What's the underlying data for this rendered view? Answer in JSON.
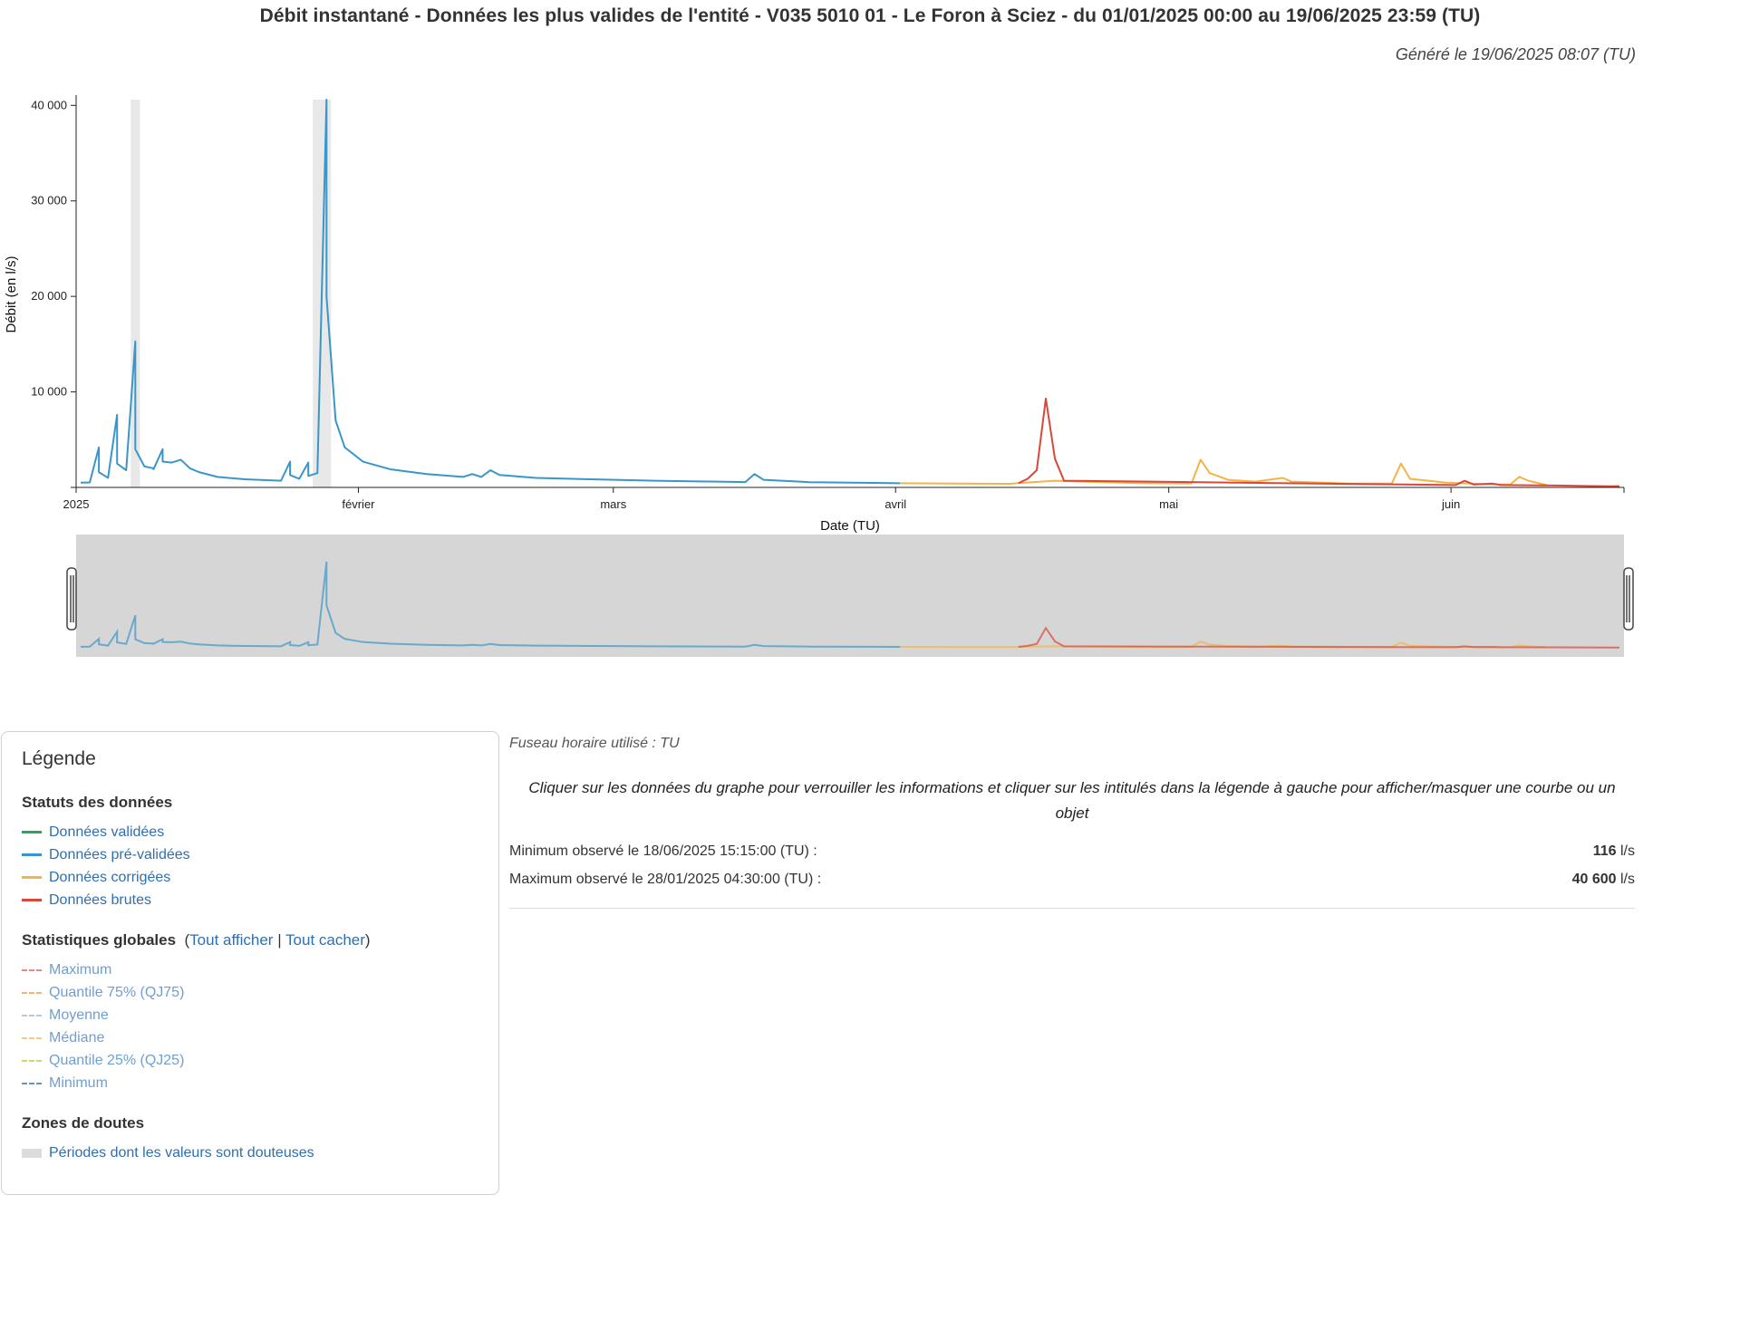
{
  "header": {
    "title": "Débit instantané - Données les plus valides de l'entité - V035 5010 01 - Le Foron à Sciez - du 01/01/2025 00:00 au 19/06/2025 23:59 (TU)",
    "generated": "Généré le 19/06/2025 08:07 (TU)"
  },
  "chart_data": {
    "type": "line",
    "title": "",
    "xlabel": "Date (TU)",
    "ylabel": "Débit (en l/s)",
    "ylim": [
      0,
      40600
    ],
    "yticks": [
      0,
      10000,
      20000,
      30000,
      40000
    ],
    "ytick_labels": [
      "",
      "10 000",
      "20 000",
      "30 000",
      "40 000"
    ],
    "xlim": [
      "2025-01-01",
      "2025-06-19"
    ],
    "xticks": [
      "2025-01-01",
      "2025-02-01",
      "2025-03-01",
      "2025-04-01",
      "2025-05-01",
      "2025-06-01"
    ],
    "xtick_labels": [
      "2025",
      "février",
      "mars",
      "avril",
      "mai",
      "juin"
    ],
    "doubt_zones": [
      [
        "2025-01-07",
        "2025-01-07"
      ],
      [
        "2025-01-27",
        "2025-01-28"
      ]
    ],
    "series": [
      {
        "name": "Données pré-validées",
        "color": "#3a96c8",
        "points": [
          [
            "2025-01-01",
            500
          ],
          [
            "2025-01-02",
            520
          ],
          [
            "2025-01-03",
            4200
          ],
          [
            "2025-01-03",
            1600
          ],
          [
            "2025-01-04",
            1000
          ],
          [
            "2025-01-05",
            7600
          ],
          [
            "2025-01-05",
            2500
          ],
          [
            "2025-01-06",
            1800
          ],
          [
            "2025-01-07",
            15300
          ],
          [
            "2025-01-07",
            4000
          ],
          [
            "2025-01-08",
            2200
          ],
          [
            "2025-01-09",
            2000
          ],
          [
            "2025-01-09",
            1900
          ],
          [
            "2025-01-10",
            4000
          ],
          [
            "2025-01-10",
            2700
          ],
          [
            "2025-01-11",
            2600
          ],
          [
            "2025-01-12",
            2900
          ],
          [
            "2025-01-13",
            2000
          ],
          [
            "2025-01-14",
            1600
          ],
          [
            "2025-01-16",
            1100
          ],
          [
            "2025-01-19",
            850
          ],
          [
            "2025-01-23",
            700
          ],
          [
            "2025-01-24",
            2700
          ],
          [
            "2025-01-24",
            1300
          ],
          [
            "2025-01-25",
            900
          ],
          [
            "2025-01-26",
            2600
          ],
          [
            "2025-01-26",
            1200
          ],
          [
            "2025-01-27",
            1500
          ],
          [
            "2025-01-28",
            40600
          ],
          [
            "2025-01-28",
            20000
          ],
          [
            "2025-01-29",
            7000
          ],
          [
            "2025-01-30",
            4200
          ],
          [
            "2025-02-01",
            2700
          ],
          [
            "2025-02-04",
            1900
          ],
          [
            "2025-02-08",
            1400
          ],
          [
            "2025-02-12",
            1100
          ],
          [
            "2025-02-13",
            1400
          ],
          [
            "2025-02-14",
            1100
          ],
          [
            "2025-02-15",
            1800
          ],
          [
            "2025-02-16",
            1300
          ],
          [
            "2025-02-20",
            1000
          ],
          [
            "2025-02-26",
            850
          ],
          [
            "2025-03-05",
            700
          ],
          [
            "2025-03-12",
            600
          ],
          [
            "2025-03-15",
            560
          ],
          [
            "2025-03-16",
            1400
          ],
          [
            "2025-03-17",
            800
          ],
          [
            "2025-03-22",
            550
          ],
          [
            "2025-03-29",
            470
          ],
          [
            "2025-04-01",
            440
          ]
        ]
      },
      {
        "name": "Données corrigées",
        "color": "#f4b445",
        "points": [
          [
            "2025-04-01",
            440
          ],
          [
            "2025-04-07",
            400
          ],
          [
            "2025-04-13",
            380
          ],
          [
            "2025-04-14",
            450
          ],
          [
            "2025-04-18",
            700
          ],
          [
            "2025-04-21",
            600
          ],
          [
            "2025-04-27",
            450
          ],
          [
            "2025-05-03",
            420
          ],
          [
            "2025-05-04",
            2900
          ],
          [
            "2025-05-05",
            1500
          ],
          [
            "2025-05-07",
            800
          ],
          [
            "2025-05-10",
            600
          ],
          [
            "2025-05-13",
            1000
          ],
          [
            "2025-05-14",
            600
          ],
          [
            "2025-05-20",
            420
          ],
          [
            "2025-05-25",
            400
          ],
          [
            "2025-05-26",
            2500
          ],
          [
            "2025-05-27",
            900
          ],
          [
            "2025-05-31",
            500
          ],
          [
            "2025-06-04",
            350
          ],
          [
            "2025-06-07",
            300
          ],
          [
            "2025-06-08",
            1100
          ],
          [
            "2025-06-09",
            700
          ],
          [
            "2025-06-11",
            250
          ]
        ]
      },
      {
        "name": "Données brutes",
        "color": "#d9473a",
        "points": [
          [
            "2025-04-14",
            450
          ],
          [
            "2025-04-15",
            900
          ],
          [
            "2025-04-16",
            1800
          ],
          [
            "2025-04-17",
            9300
          ],
          [
            "2025-04-18",
            3000
          ],
          [
            "2025-04-19",
            700
          ],
          [
            "2025-06-01",
            250
          ],
          [
            "2025-06-02",
            700
          ],
          [
            "2025-06-03",
            300
          ],
          [
            "2025-06-05",
            400
          ],
          [
            "2025-06-06",
            250
          ],
          [
            "2025-06-12",
            200
          ],
          [
            "2025-06-15",
            150
          ],
          [
            "2025-06-18",
            116
          ],
          [
            "2025-06-19",
            130
          ]
        ]
      }
    ],
    "min": {
      "date": "2025-06-18 15:15",
      "value": 116
    },
    "max": {
      "date": "2025-01-28 04:30",
      "value": 40600
    }
  },
  "legend": {
    "title": "Légende",
    "status_title": "Statuts des données",
    "statuses": [
      {
        "label": "Données validées",
        "color": "#2aa55a"
      },
      {
        "label": "Données pré-validées",
        "color": "#3a96c8"
      },
      {
        "label": "Données corrigées",
        "color": "#f4b445"
      },
      {
        "label": "Données brutes",
        "color": "#d9473a"
      }
    ],
    "stats_title": "Statistiques globales",
    "show_all": "Tout afficher",
    "hide_all": "Tout cacher",
    "stats": [
      {
        "label": "Maximum",
        "color": "#e88a8a"
      },
      {
        "label": "Quantile 75% (QJ75)",
        "color": "#f1b36b"
      },
      {
        "label": "Moyenne",
        "color": "#b9c7d6"
      },
      {
        "label": "Médiane",
        "color": "#f3c98a"
      },
      {
        "label": "Quantile 25% (QJ25)",
        "color": "#c9d96a"
      },
      {
        "label": "Minimum",
        "color": "#6a93c2"
      }
    ],
    "zones_title": "Zones de doutes",
    "zone_label": "Périodes dont les valeurs sont douteuses"
  },
  "info": {
    "timezone": "Fuseau horaire utilisé : TU",
    "hint": "Cliquer sur les données du graphe pour verrouiller les informations et cliquer sur les intitulés dans la légende à gauche pour afficher/masquer une courbe ou un objet",
    "min_label": "Minimum observé le 18/06/2025 15:15:00 (TU) :",
    "min_value": "116",
    "max_label": "Maximum observé le 28/01/2025 04:30:00 (TU) :",
    "max_value": "40 600",
    "unit": "l/s"
  }
}
